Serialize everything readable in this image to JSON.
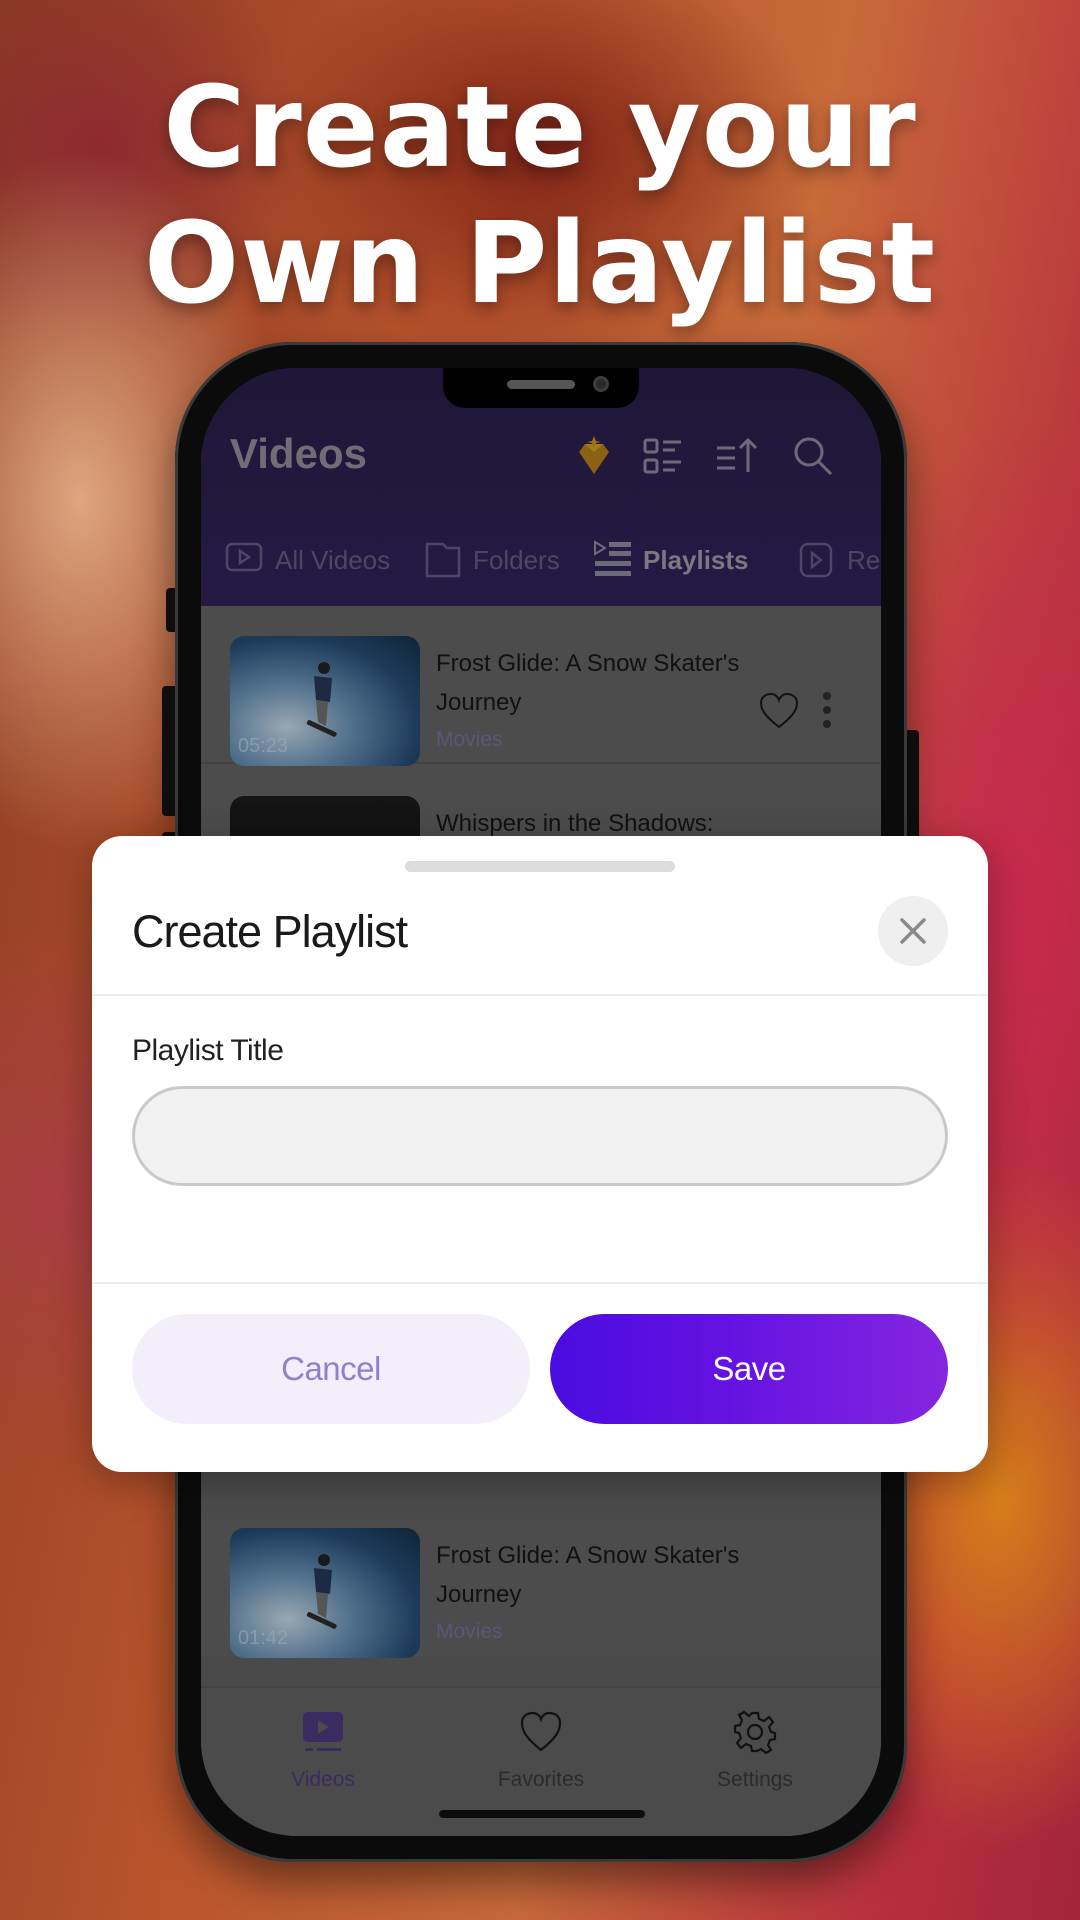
{
  "headline": {
    "line1": "Create your",
    "line2": "Own Playlist"
  },
  "app": {
    "title": "Videos",
    "top_icons": [
      "premium-gem-icon",
      "layout-grid-icon",
      "sort-icon",
      "search-icon"
    ],
    "tabs": [
      {
        "label": "All Videos",
        "icon": "video-icon",
        "active": false
      },
      {
        "label": "Folders",
        "icon": "folder-icon",
        "active": false
      },
      {
        "label": "Playlists",
        "icon": "playlist-icon",
        "active": true
      },
      {
        "label": "Rece",
        "icon": "recent-icon",
        "active": false
      }
    ],
    "videos": [
      {
        "title": "Frost Glide: A Snow Skater's Journey",
        "category": "Movies",
        "duration": "05:23"
      },
      {
        "title": "Whispers in the Shadows:",
        "category": "",
        "duration": ""
      },
      {
        "title": "Frost Glide: A Snow Skater's Journey",
        "category": "Movies",
        "duration": "01:42"
      }
    ],
    "fab_icon": "plus-icon",
    "bottom_nav": [
      {
        "label": "Videos",
        "icon": "video-icon",
        "active": true
      },
      {
        "label": "Favorites",
        "icon": "heart-icon",
        "active": false
      },
      {
        "label": "Settings",
        "icon": "gear-icon",
        "active": false
      }
    ]
  },
  "modal": {
    "title": "Create Playlist",
    "field_label": "Playlist Title",
    "field_value": "",
    "field_placeholder": "",
    "cancel_label": "Cancel",
    "save_label": "Save"
  },
  "colors": {
    "accent": "#5a10e0",
    "accent_end": "#8526e0",
    "cancel_bg": "#f2effa",
    "cancel_text": "#9080cc"
  }
}
